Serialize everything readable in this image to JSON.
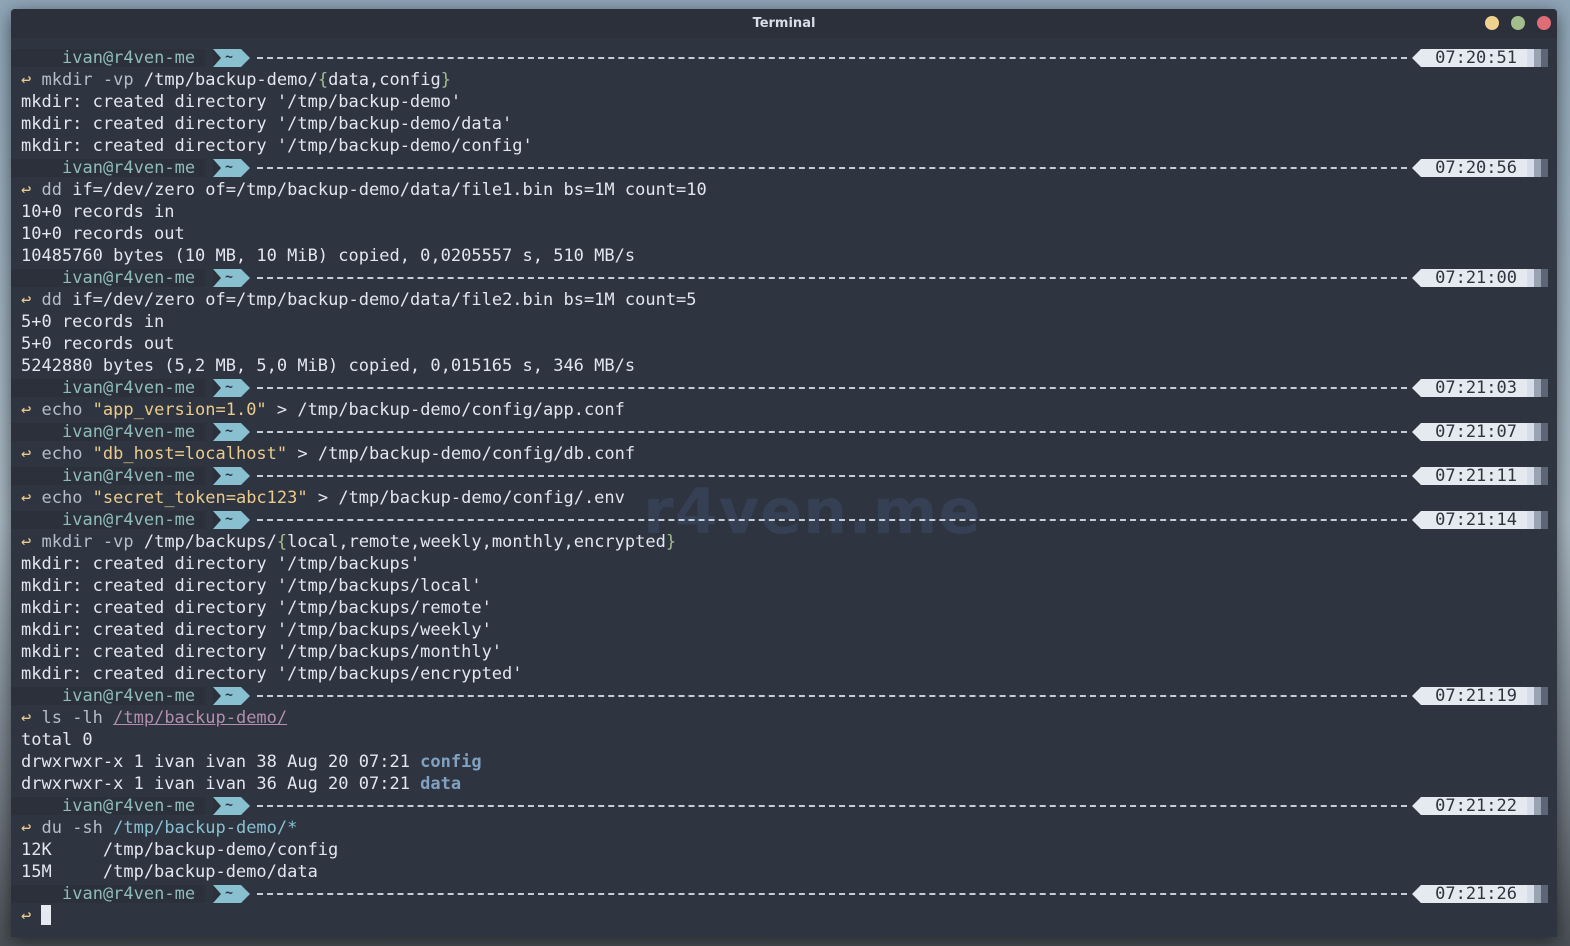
{
  "window": {
    "title": "Terminal",
    "buttons": [
      {
        "name": "minimize",
        "color": "#f0d290"
      },
      {
        "name": "maximize",
        "color": "#a3be8c"
      },
      {
        "name": "close",
        "color": "#e06c75"
      }
    ]
  },
  "watermark": "r4ven.me",
  "prompt": {
    "user_host": "ivan@r4ven-me",
    "dir": "~",
    "arrow": "↩︎"
  },
  "lines": [
    {
      "type": "prompt",
      "time": "07:20:51"
    },
    {
      "type": "cmd",
      "parts": [
        {
          "t": "mkdir -vp ",
          "c": "cmd"
        },
        {
          "t": "/tmp/backup-demo/",
          "c": "plain"
        },
        {
          "t": "{",
          "c": "brace"
        },
        {
          "t": "data,config",
          "c": "plain"
        },
        {
          "t": "}",
          "c": "brace"
        }
      ]
    },
    {
      "type": "out",
      "text": "mkdir: created directory '/tmp/backup-demo'"
    },
    {
      "type": "out",
      "text": "mkdir: created directory '/tmp/backup-demo/data'"
    },
    {
      "type": "out",
      "text": "mkdir: created directory '/tmp/backup-demo/config'"
    },
    {
      "type": "prompt",
      "time": "07:20:56"
    },
    {
      "type": "cmd",
      "parts": [
        {
          "t": "dd ",
          "c": "cmd"
        },
        {
          "t": "if=/dev/zero of=/tmp/backup-demo/data/file1.bin bs=1M count=10",
          "c": "plain"
        }
      ]
    },
    {
      "type": "out",
      "text": "10+0 records in"
    },
    {
      "type": "out",
      "text": "10+0 records out"
    },
    {
      "type": "out",
      "text": "10485760 bytes (10 MB, 10 MiB) copied, 0,0205557 s, 510 MB/s"
    },
    {
      "type": "prompt",
      "time": "07:21:00"
    },
    {
      "type": "cmd",
      "parts": [
        {
          "t": "dd ",
          "c": "cmd"
        },
        {
          "t": "if=/dev/zero of=/tmp/backup-demo/data/file2.bin bs=1M count=5",
          "c": "plain"
        }
      ]
    },
    {
      "type": "out",
      "text": "5+0 records in"
    },
    {
      "type": "out",
      "text": "5+0 records out"
    },
    {
      "type": "out",
      "text": "5242880 bytes (5,2 MB, 5,0 MiB) copied, 0,015165 s, 346 MB/s"
    },
    {
      "type": "prompt",
      "time": "07:21:03"
    },
    {
      "type": "cmd",
      "parts": [
        {
          "t": "echo ",
          "c": "cmd"
        },
        {
          "t": "\"app_version=1.0\"",
          "c": "str"
        },
        {
          "t": " > /tmp/backup-demo/config/app.conf",
          "c": "plain"
        }
      ]
    },
    {
      "type": "prompt",
      "time": "07:21:07"
    },
    {
      "type": "cmd",
      "parts": [
        {
          "t": "echo ",
          "c": "cmd"
        },
        {
          "t": "\"db_host=localhost\"",
          "c": "str"
        },
        {
          "t": " > /tmp/backup-demo/config/db.conf",
          "c": "plain"
        }
      ]
    },
    {
      "type": "prompt",
      "time": "07:21:11"
    },
    {
      "type": "cmd",
      "parts": [
        {
          "t": "echo ",
          "c": "cmd"
        },
        {
          "t": "\"secret_token=abc123\"",
          "c": "str"
        },
        {
          "t": " > /tmp/backup-demo/config/.env",
          "c": "plain"
        }
      ]
    },
    {
      "type": "prompt",
      "time": "07:21:14"
    },
    {
      "type": "cmd",
      "parts": [
        {
          "t": "mkdir -vp ",
          "c": "cmd"
        },
        {
          "t": "/tmp/backups/",
          "c": "plain"
        },
        {
          "t": "{",
          "c": "brace"
        },
        {
          "t": "local,remote,weekly,monthly,encrypted",
          "c": "plain"
        },
        {
          "t": "}",
          "c": "brace"
        }
      ]
    },
    {
      "type": "out",
      "text": "mkdir: created directory '/tmp/backups'"
    },
    {
      "type": "out",
      "text": "mkdir: created directory '/tmp/backups/local'"
    },
    {
      "type": "out",
      "text": "mkdir: created directory '/tmp/backups/remote'"
    },
    {
      "type": "out",
      "text": "mkdir: created directory '/tmp/backups/weekly'"
    },
    {
      "type": "out",
      "text": "mkdir: created directory '/tmp/backups/monthly'"
    },
    {
      "type": "out",
      "text": "mkdir: created directory '/tmp/backups/encrypted'"
    },
    {
      "type": "prompt",
      "time": "07:21:19"
    },
    {
      "type": "cmd",
      "parts": [
        {
          "t": "ls -lh ",
          "c": "cmd"
        },
        {
          "t": "/tmp/backup-demo/",
          "c": "path-ul"
        }
      ]
    },
    {
      "type": "out",
      "text": "total 0"
    },
    {
      "type": "outparts",
      "parts": [
        {
          "t": "drwxrwxr-x 1 ivan ivan 38 Aug 20 07:21 ",
          "c": "plain"
        },
        {
          "t": "config",
          "c": "dirname"
        }
      ]
    },
    {
      "type": "outparts",
      "parts": [
        {
          "t": "drwxrwxr-x 1 ivan ivan 36 Aug 20 07:21 ",
          "c": "plain"
        },
        {
          "t": "data",
          "c": "dirname"
        }
      ]
    },
    {
      "type": "prompt",
      "time": "07:21:22"
    },
    {
      "type": "cmd",
      "parts": [
        {
          "t": "du -sh ",
          "c": "cmd"
        },
        {
          "t": "/tmp/backup-demo/*",
          "c": "pathb"
        }
      ]
    },
    {
      "type": "out",
      "text": "12K     /tmp/backup-demo/config"
    },
    {
      "type": "out",
      "text": "15M     /tmp/backup-demo/data"
    },
    {
      "type": "prompt",
      "time": "07:21:26"
    },
    {
      "type": "input",
      "parts": []
    }
  ]
}
